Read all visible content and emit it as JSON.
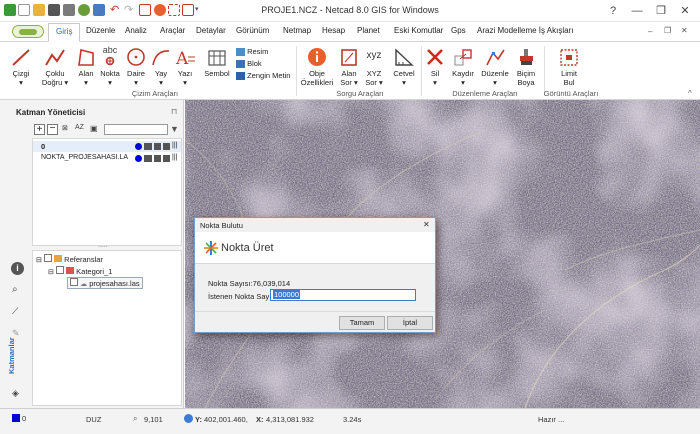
{
  "app": {
    "title": "PROJE1.NCZ - Netcad 8.0 GIS for Windows",
    "help": "?",
    "minimize": "—",
    "restore": "❐",
    "close": "✕"
  },
  "tabs": [
    "Giriş",
    "Düzenle",
    "Analiz",
    "Araçlar",
    "Detaylar",
    "Görünüm",
    "Netmap",
    "Hesap",
    "Planet",
    "Eski Komutlar",
    "Gps",
    "Arazi Modelleme İş Akışları"
  ],
  "ribbon": {
    "groups": [
      "Çizim Araçları",
      "Sorgu Araçları",
      "Düzenleme Araçları",
      "Görüntü Araçları"
    ],
    "draw": [
      {
        "l1": "Çizgi",
        "l2": "▾"
      },
      {
        "l1": "Çoklu",
        "l2": "Doğru ▾"
      },
      {
        "l1": "Alan",
        "l2": "▾"
      },
      {
        "l1": "Nokta",
        "l2": "▾"
      },
      {
        "l1": "Daire",
        "l2": "▾"
      },
      {
        "l1": "Yay",
        "l2": "▾"
      },
      {
        "l1": "Yazı",
        "l2": "▾"
      },
      {
        "l1": "Sembol",
        "l2": ""
      }
    ],
    "draw_small": [
      "Resim",
      "Blok",
      "Zengin Metin"
    ],
    "query": [
      {
        "l1": "Obje",
        "l2": "Özellikleri"
      },
      {
        "l1": "Alan",
        "l2": "Sor ▾"
      },
      {
        "l1": "XYZ",
        "l2": "Sor ▾"
      },
      {
        "l1": "Cetvel",
        "l2": "▾"
      }
    ],
    "edit": [
      {
        "l1": "Sil",
        "l2": "▾"
      },
      {
        "l1": "Kaydır",
        "l2": "▾"
      },
      {
        "l1": "Düzenle",
        "l2": "▾"
      },
      {
        "l1": "Biçim",
        "l2": "Boya"
      }
    ],
    "view": [
      {
        "l1": "Limit",
        "l2": "Bul"
      }
    ],
    "abc": "abc",
    "xyz": "xyz",
    "collapse": "^"
  },
  "panel": {
    "title": "Katman Yöneticisi",
    "pin": "⊓",
    "layers": [
      {
        "name": "0"
      },
      {
        "name": "NOKTA_PROJESAHASI.LA"
      }
    ],
    "splitter": ".....",
    "tree": [
      {
        "label": "Referanslar"
      },
      {
        "label": "Kategori_1"
      },
      {
        "label": "projesahası.las"
      }
    ],
    "vertical_label": "Katmanlar"
  },
  "status": {
    "layer": "0",
    "mode": "DUZ",
    "scale": "9,101",
    "y_label": "Y:",
    "y_value": "402,001.460,",
    "x_label": "X:",
    "x_value": "4,313,081.932",
    "time": "3.24s",
    "ready": "Hazır ..."
  },
  "dialog": {
    "title": "Nokta Bulutu",
    "close": "✕",
    "header": "Nokta Üret",
    "count_label": "Nokta Sayısı:76,039,014",
    "requested_label": "İstenen Nokta Sayısı",
    "requested_value": "100000",
    "ok": "Tamam",
    "cancel": "İptal"
  },
  "colors": {
    "accent": "#2a6ebb",
    "delete_red": "#d9261c",
    "info_orange": "#e8612c"
  }
}
